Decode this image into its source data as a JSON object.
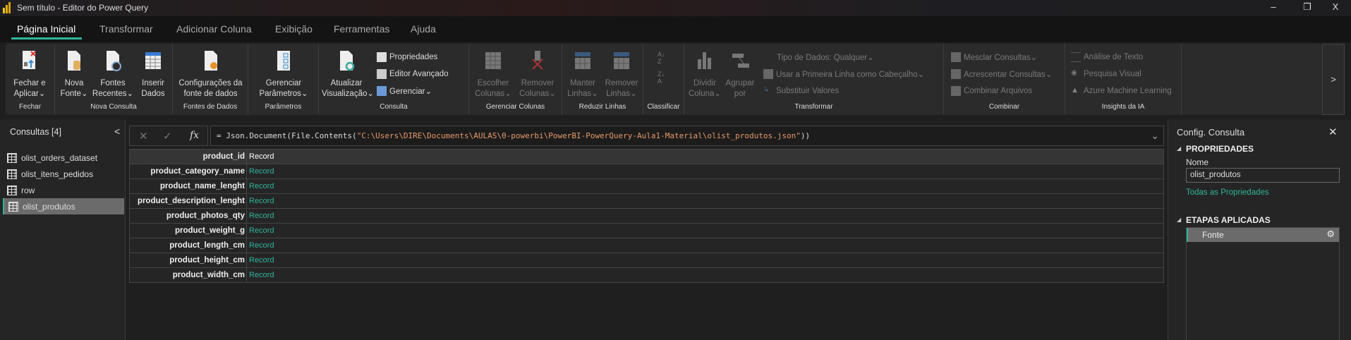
{
  "window": {
    "title": "Sem título - Editor do Power Query",
    "minimize": "–",
    "restore": "❐",
    "close": "X"
  },
  "tabs": [
    "Página Inicial",
    "Transformar",
    "Adicionar Coluna",
    "Exibição",
    "Ferramentas",
    "Ajuda"
  ],
  "ribbon": {
    "groups": [
      "Fechar",
      "Nova Consulta",
      "Fontes de Dados",
      "Parâmetros",
      "Consulta",
      "Gerenciar Colunas",
      "Reduzir Linhas",
      "Classificar",
      "Transformar",
      "Combinar",
      "Insights da IA"
    ],
    "fechar_aplicar": [
      "Fechar e",
      "Aplicar⌄"
    ],
    "nova_fonte": [
      "Nova",
      "Fonte⌄"
    ],
    "fontes_recentes": [
      "Fontes",
      "Recentes⌄"
    ],
    "inserir_dados": [
      "Inserir",
      "Dados"
    ],
    "config_fonte": [
      "Configurações da",
      "fonte de dados"
    ],
    "gerenciar_parametros": [
      "Gerenciar",
      "Parâmetros⌄"
    ],
    "atualizar": [
      "Atualizar",
      "Visualização⌄"
    ],
    "propriedades": "Propriedades",
    "editor_avancado": "Editor Avançado",
    "gerenciar": "Gerenciar⌄",
    "escolher_colunas": [
      "Escolher",
      "Colunas⌄"
    ],
    "remover_colunas": [
      "Remover",
      "Colunas⌄"
    ],
    "manter_linhas": [
      "Manter",
      "Linhas⌄"
    ],
    "remover_linhas": [
      "Remover",
      "Linhas⌄"
    ],
    "dividir_coluna": [
      "Dividir",
      "Coluna⌄"
    ],
    "agrupar_por": [
      "Agrupar",
      "por"
    ],
    "tipo_dados": "Tipo de Dados: Qualquer⌄",
    "primeira_linha": "Usar a Primeira Linha como Cabeçalho⌄",
    "substituir": "Substituir Valores",
    "mesclar": "Mesclar Consultas⌄",
    "acrescentar": "Acrescentar Consultas⌄",
    "combinar_arquivos": "Combinar Arquivos",
    "analise_texto": "Análise de Texto",
    "pesquisa_visual": "Pesquisa Visual",
    "azure_ml": "Azure Machine Learning",
    "scroll": ">"
  },
  "queries": {
    "title": "Consultas [4]",
    "collapse": "<",
    "items": [
      "olist_orders_dataset",
      "olist_itens_pedidos",
      "row",
      "olist_produtos"
    ],
    "selected": "olist_produtos"
  },
  "formula": {
    "cancel": "✕",
    "confirm": "✓",
    "fx": "fx",
    "prefix": "= Json.Document(File.Contents(",
    "path": "\"C:\\Users\\DIRE\\Documents\\AULAS\\0-powerbi\\PowerBI-PowerQuery-Aula1-Material\\olist_produtos.json\"",
    "suffix": "))",
    "expand": "⌄"
  },
  "grid": {
    "rows": [
      {
        "name": "product_id",
        "value": "Record"
      },
      {
        "name": "product_category_name",
        "value": "Record"
      },
      {
        "name": "product_name_lenght",
        "value": "Record"
      },
      {
        "name": "product_description_lenght",
        "value": "Record"
      },
      {
        "name": "product_photos_qty",
        "value": "Record"
      },
      {
        "name": "product_weight_g",
        "value": "Record"
      },
      {
        "name": "product_length_cm",
        "value": "Record"
      },
      {
        "name": "product_height_cm",
        "value": "Record"
      },
      {
        "name": "product_width_cm",
        "value": "Record"
      }
    ]
  },
  "settings": {
    "title": "Config. Consulta",
    "close": "✕",
    "properties_header": "PROPRIEDADES",
    "name_label": "Nome",
    "name_value": "olist_produtos",
    "all_properties": "Todas as Propriedades",
    "steps_header": "ETAPAS APLICADAS",
    "steps": [
      "Fonte"
    ]
  },
  "colors": {
    "accent": "#2fb59a",
    "background": "#1f1f1f",
    "ribbon": "#2b2b2b"
  }
}
